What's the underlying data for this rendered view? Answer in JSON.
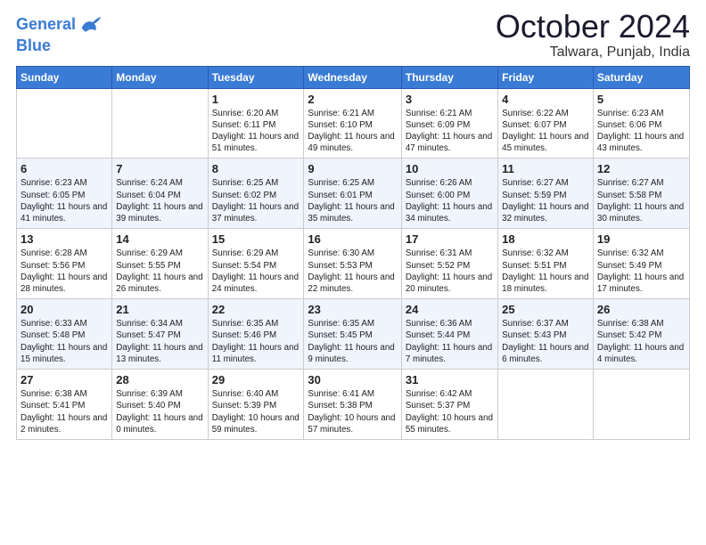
{
  "header": {
    "logo_line1": "General",
    "logo_line2": "Blue",
    "title": "October 2024",
    "subtitle": "Talwara, Punjab, India"
  },
  "days_of_week": [
    "Sunday",
    "Monday",
    "Tuesday",
    "Wednesday",
    "Thursday",
    "Friday",
    "Saturday"
  ],
  "weeks": [
    [
      {
        "day": "",
        "info": ""
      },
      {
        "day": "",
        "info": ""
      },
      {
        "day": "1",
        "info": "Sunrise: 6:20 AM\nSunset: 6:11 PM\nDaylight: 11 hours and 51 minutes."
      },
      {
        "day": "2",
        "info": "Sunrise: 6:21 AM\nSunset: 6:10 PM\nDaylight: 11 hours and 49 minutes."
      },
      {
        "day": "3",
        "info": "Sunrise: 6:21 AM\nSunset: 6:09 PM\nDaylight: 11 hours and 47 minutes."
      },
      {
        "day": "4",
        "info": "Sunrise: 6:22 AM\nSunset: 6:07 PM\nDaylight: 11 hours and 45 minutes."
      },
      {
        "day": "5",
        "info": "Sunrise: 6:23 AM\nSunset: 6:06 PM\nDaylight: 11 hours and 43 minutes."
      }
    ],
    [
      {
        "day": "6",
        "info": "Sunrise: 6:23 AM\nSunset: 6:05 PM\nDaylight: 11 hours and 41 minutes."
      },
      {
        "day": "7",
        "info": "Sunrise: 6:24 AM\nSunset: 6:04 PM\nDaylight: 11 hours and 39 minutes."
      },
      {
        "day": "8",
        "info": "Sunrise: 6:25 AM\nSunset: 6:02 PM\nDaylight: 11 hours and 37 minutes."
      },
      {
        "day": "9",
        "info": "Sunrise: 6:25 AM\nSunset: 6:01 PM\nDaylight: 11 hours and 35 minutes."
      },
      {
        "day": "10",
        "info": "Sunrise: 6:26 AM\nSunset: 6:00 PM\nDaylight: 11 hours and 34 minutes."
      },
      {
        "day": "11",
        "info": "Sunrise: 6:27 AM\nSunset: 5:59 PM\nDaylight: 11 hours and 32 minutes."
      },
      {
        "day": "12",
        "info": "Sunrise: 6:27 AM\nSunset: 5:58 PM\nDaylight: 11 hours and 30 minutes."
      }
    ],
    [
      {
        "day": "13",
        "info": "Sunrise: 6:28 AM\nSunset: 5:56 PM\nDaylight: 11 hours and 28 minutes."
      },
      {
        "day": "14",
        "info": "Sunrise: 6:29 AM\nSunset: 5:55 PM\nDaylight: 11 hours and 26 minutes."
      },
      {
        "day": "15",
        "info": "Sunrise: 6:29 AM\nSunset: 5:54 PM\nDaylight: 11 hours and 24 minutes."
      },
      {
        "day": "16",
        "info": "Sunrise: 6:30 AM\nSunset: 5:53 PM\nDaylight: 11 hours and 22 minutes."
      },
      {
        "day": "17",
        "info": "Sunrise: 6:31 AM\nSunset: 5:52 PM\nDaylight: 11 hours and 20 minutes."
      },
      {
        "day": "18",
        "info": "Sunrise: 6:32 AM\nSunset: 5:51 PM\nDaylight: 11 hours and 18 minutes."
      },
      {
        "day": "19",
        "info": "Sunrise: 6:32 AM\nSunset: 5:49 PM\nDaylight: 11 hours and 17 minutes."
      }
    ],
    [
      {
        "day": "20",
        "info": "Sunrise: 6:33 AM\nSunset: 5:48 PM\nDaylight: 11 hours and 15 minutes."
      },
      {
        "day": "21",
        "info": "Sunrise: 6:34 AM\nSunset: 5:47 PM\nDaylight: 11 hours and 13 minutes."
      },
      {
        "day": "22",
        "info": "Sunrise: 6:35 AM\nSunset: 5:46 PM\nDaylight: 11 hours and 11 minutes."
      },
      {
        "day": "23",
        "info": "Sunrise: 6:35 AM\nSunset: 5:45 PM\nDaylight: 11 hours and 9 minutes."
      },
      {
        "day": "24",
        "info": "Sunrise: 6:36 AM\nSunset: 5:44 PM\nDaylight: 11 hours and 7 minutes."
      },
      {
        "day": "25",
        "info": "Sunrise: 6:37 AM\nSunset: 5:43 PM\nDaylight: 11 hours and 6 minutes."
      },
      {
        "day": "26",
        "info": "Sunrise: 6:38 AM\nSunset: 5:42 PM\nDaylight: 11 hours and 4 minutes."
      }
    ],
    [
      {
        "day": "27",
        "info": "Sunrise: 6:38 AM\nSunset: 5:41 PM\nDaylight: 11 hours and 2 minutes."
      },
      {
        "day": "28",
        "info": "Sunrise: 6:39 AM\nSunset: 5:40 PM\nDaylight: 11 hours and 0 minutes."
      },
      {
        "day": "29",
        "info": "Sunrise: 6:40 AM\nSunset: 5:39 PM\nDaylight: 10 hours and 59 minutes."
      },
      {
        "day": "30",
        "info": "Sunrise: 6:41 AM\nSunset: 5:38 PM\nDaylight: 10 hours and 57 minutes."
      },
      {
        "day": "31",
        "info": "Sunrise: 6:42 AM\nSunset: 5:37 PM\nDaylight: 10 hours and 55 minutes."
      },
      {
        "day": "",
        "info": ""
      },
      {
        "day": "",
        "info": ""
      }
    ]
  ]
}
